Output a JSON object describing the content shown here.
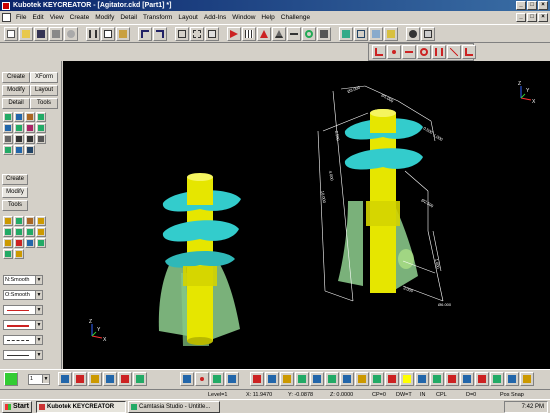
{
  "window": {
    "title": "Kubotek KEYCREATOR - [Agitator.ckd [Part1] *]"
  },
  "menu": {
    "items": [
      "File",
      "Edit",
      "View",
      "Create",
      "Modify",
      "Detail",
      "Transform",
      "Layout",
      "Add-Ins",
      "Window",
      "Help",
      "Challenge"
    ]
  },
  "left_panel": {
    "tabs_top": [
      "Create",
      "XForm",
      "Modify",
      "Layout",
      "Detail",
      "Tools"
    ],
    "tabs_mid": [
      "Create",
      "Modify",
      "Tools"
    ],
    "dropdowns": [
      "N:Smooth",
      "O:Smooth"
    ]
  },
  "viewport": {
    "bg": "#000000",
    "colors": {
      "shaft": "#e6e600",
      "flight": "#33cccc",
      "fins": "#99dd99",
      "dims": "#ffffff"
    },
    "dimension_labels": [
      "Ø3.000",
      "Ø1.000",
      "2.500",
      "4.000",
      "10.000",
      "Ø2.500",
      "1.000",
      "3.000",
      "0.500",
      "1.000",
      "Ø6.000"
    ],
    "axis_labels": {
      "x": "X",
      "y": "Y",
      "z": "Z"
    }
  },
  "bottom_bar": {
    "level_value": "1"
  },
  "status": {
    "level": "Level=1",
    "x": "X: 11.9470",
    "y": "Y: -0.0878",
    "z": "Z: 0.0000",
    "cp": "CP=0",
    "dw": "DW=T",
    "in": "IN",
    "cpl": "CPL",
    "d": "D=0",
    "snap": "Pos Snap"
  },
  "taskbar": {
    "start": "Start",
    "tasks": [
      "Kubotek KEYCREATOR",
      "Camtasia Studio - Untitle..."
    ],
    "clock": "7:42 PM"
  }
}
